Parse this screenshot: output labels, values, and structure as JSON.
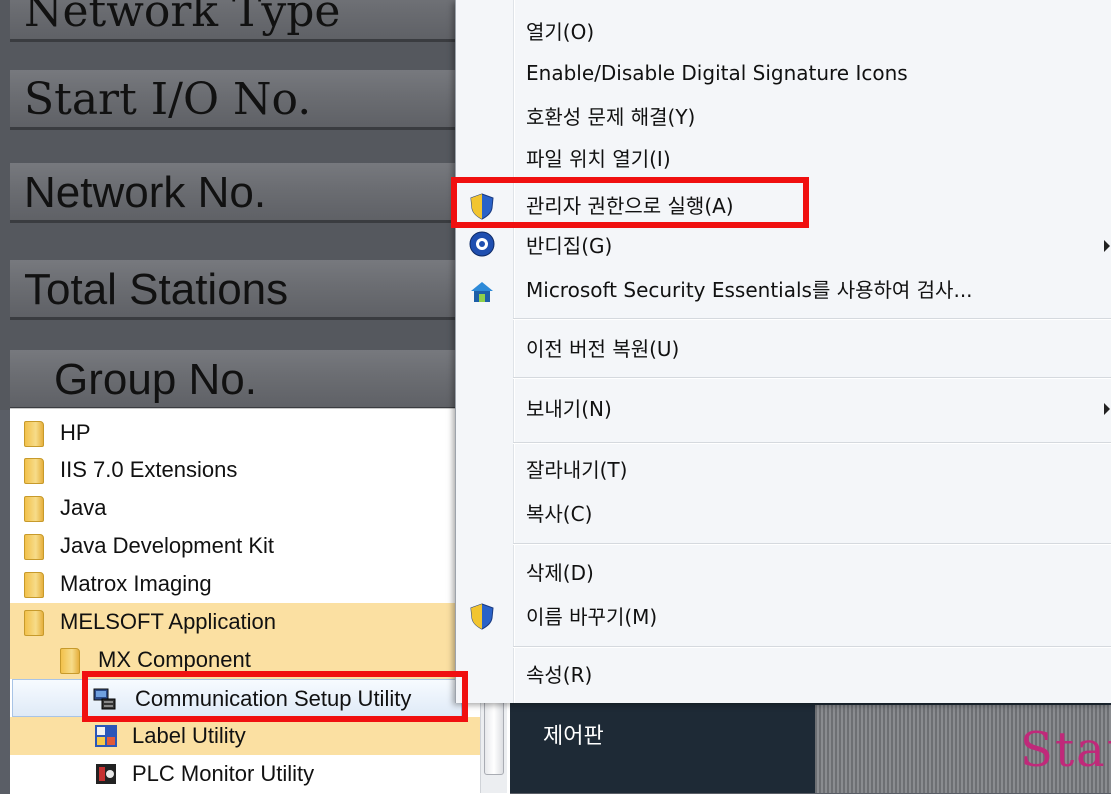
{
  "background_panel": {
    "rows": [
      "Network Type",
      "Start I/O No.",
      "Network No.",
      "Total Stations",
      "Group No."
    ]
  },
  "start_menu": {
    "items": [
      {
        "label": "HP",
        "icon": "folder-icon"
      },
      {
        "label": "IIS 7.0 Extensions",
        "icon": "folder-icon"
      },
      {
        "label": "Java",
        "icon": "folder-icon"
      },
      {
        "label": "Java Development Kit",
        "icon": "folder-icon"
      },
      {
        "label": "Matrox Imaging",
        "icon": "folder-icon"
      },
      {
        "label": "MELSOFT Application",
        "icon": "folder-icon"
      },
      {
        "label": "MX Component",
        "icon": "folder-icon"
      },
      {
        "label": "Communication Setup Utility",
        "icon": "communication-setup-icon"
      },
      {
        "label": "Label Utility",
        "icon": "label-utility-icon"
      },
      {
        "label": "PLC Monitor Utility",
        "icon": "plc-monitor-icon"
      }
    ]
  },
  "right_panel": {
    "control_panel_label": "제어판",
    "background_text": "Stat"
  },
  "context_menu": {
    "items": [
      {
        "label": "열기(O)"
      },
      {
        "label": "Enable/Disable Digital Signature Icons"
      },
      {
        "label": "호환성 문제 해결(Y)"
      },
      {
        "label": "파일 위치 열기(I)"
      },
      {
        "label": "관리자 권한으로 실행(A)",
        "icon": "uac-shield-icon"
      },
      {
        "label": "반디집(G)",
        "icon": "bandizip-icon",
        "submenu": true
      },
      {
        "label": "Microsoft Security Essentials를 사용하여 검사...",
        "icon": "security-essentials-icon"
      },
      {
        "label": "이전 버전 복원(U)"
      },
      {
        "label": "보내기(N)",
        "submenu": true
      },
      {
        "label": "잘라내기(T)"
      },
      {
        "label": "복사(C)"
      },
      {
        "label": "삭제(D)"
      },
      {
        "label": "이름 바꾸기(M)",
        "icon": "uac-shield-icon"
      },
      {
        "label": "속성(R)"
      }
    ]
  },
  "colors": {
    "highlight_box": "#f01010",
    "folder_highlight": "#fbe0a2",
    "menu_background": "#f4f6f9"
  }
}
